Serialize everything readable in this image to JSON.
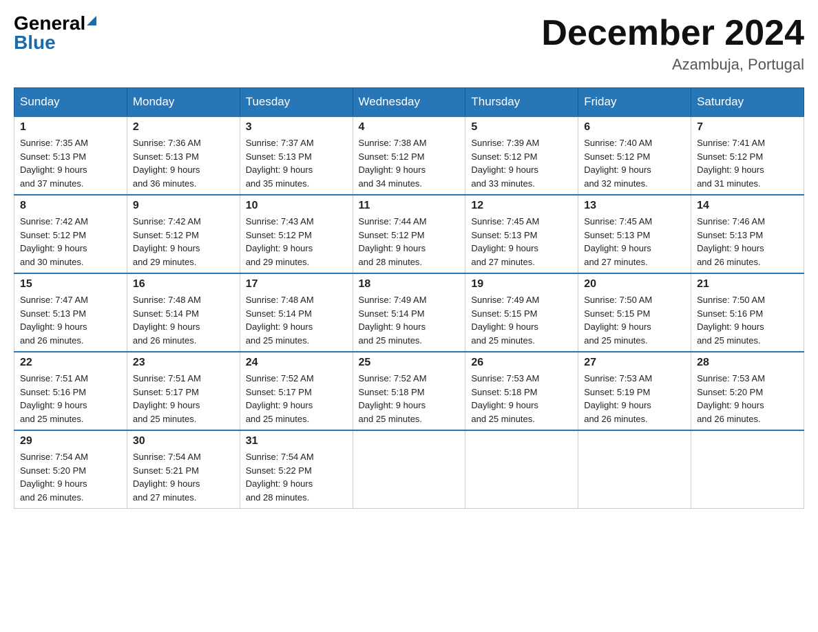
{
  "header": {
    "logo_general": "General",
    "logo_blue": "Blue",
    "month_title": "December 2024",
    "location": "Azambuja, Portugal"
  },
  "days_of_week": [
    "Sunday",
    "Monday",
    "Tuesday",
    "Wednesday",
    "Thursday",
    "Friday",
    "Saturday"
  ],
  "weeks": [
    [
      {
        "day": "1",
        "sunrise": "7:35 AM",
        "sunset": "5:13 PM",
        "daylight": "9 hours and 37 minutes."
      },
      {
        "day": "2",
        "sunrise": "7:36 AM",
        "sunset": "5:13 PM",
        "daylight": "9 hours and 36 minutes."
      },
      {
        "day": "3",
        "sunrise": "7:37 AM",
        "sunset": "5:13 PM",
        "daylight": "9 hours and 35 minutes."
      },
      {
        "day": "4",
        "sunrise": "7:38 AM",
        "sunset": "5:12 PM",
        "daylight": "9 hours and 34 minutes."
      },
      {
        "day": "5",
        "sunrise": "7:39 AM",
        "sunset": "5:12 PM",
        "daylight": "9 hours and 33 minutes."
      },
      {
        "day": "6",
        "sunrise": "7:40 AM",
        "sunset": "5:12 PM",
        "daylight": "9 hours and 32 minutes."
      },
      {
        "day": "7",
        "sunrise": "7:41 AM",
        "sunset": "5:12 PM",
        "daylight": "9 hours and 31 minutes."
      }
    ],
    [
      {
        "day": "8",
        "sunrise": "7:42 AM",
        "sunset": "5:12 PM",
        "daylight": "9 hours and 30 minutes."
      },
      {
        "day": "9",
        "sunrise": "7:42 AM",
        "sunset": "5:12 PM",
        "daylight": "9 hours and 29 minutes."
      },
      {
        "day": "10",
        "sunrise": "7:43 AM",
        "sunset": "5:12 PM",
        "daylight": "9 hours and 29 minutes."
      },
      {
        "day": "11",
        "sunrise": "7:44 AM",
        "sunset": "5:12 PM",
        "daylight": "9 hours and 28 minutes."
      },
      {
        "day": "12",
        "sunrise": "7:45 AM",
        "sunset": "5:13 PM",
        "daylight": "9 hours and 27 minutes."
      },
      {
        "day": "13",
        "sunrise": "7:45 AM",
        "sunset": "5:13 PM",
        "daylight": "9 hours and 27 minutes."
      },
      {
        "day": "14",
        "sunrise": "7:46 AM",
        "sunset": "5:13 PM",
        "daylight": "9 hours and 26 minutes."
      }
    ],
    [
      {
        "day": "15",
        "sunrise": "7:47 AM",
        "sunset": "5:13 PM",
        "daylight": "9 hours and 26 minutes."
      },
      {
        "day": "16",
        "sunrise": "7:48 AM",
        "sunset": "5:14 PM",
        "daylight": "9 hours and 26 minutes."
      },
      {
        "day": "17",
        "sunrise": "7:48 AM",
        "sunset": "5:14 PM",
        "daylight": "9 hours and 25 minutes."
      },
      {
        "day": "18",
        "sunrise": "7:49 AM",
        "sunset": "5:14 PM",
        "daylight": "9 hours and 25 minutes."
      },
      {
        "day": "19",
        "sunrise": "7:49 AM",
        "sunset": "5:15 PM",
        "daylight": "9 hours and 25 minutes."
      },
      {
        "day": "20",
        "sunrise": "7:50 AM",
        "sunset": "5:15 PM",
        "daylight": "9 hours and 25 minutes."
      },
      {
        "day": "21",
        "sunrise": "7:50 AM",
        "sunset": "5:16 PM",
        "daylight": "9 hours and 25 minutes."
      }
    ],
    [
      {
        "day": "22",
        "sunrise": "7:51 AM",
        "sunset": "5:16 PM",
        "daylight": "9 hours and 25 minutes."
      },
      {
        "day": "23",
        "sunrise": "7:51 AM",
        "sunset": "5:17 PM",
        "daylight": "9 hours and 25 minutes."
      },
      {
        "day": "24",
        "sunrise": "7:52 AM",
        "sunset": "5:17 PM",
        "daylight": "9 hours and 25 minutes."
      },
      {
        "day": "25",
        "sunrise": "7:52 AM",
        "sunset": "5:18 PM",
        "daylight": "9 hours and 25 minutes."
      },
      {
        "day": "26",
        "sunrise": "7:53 AM",
        "sunset": "5:18 PM",
        "daylight": "9 hours and 25 minutes."
      },
      {
        "day": "27",
        "sunrise": "7:53 AM",
        "sunset": "5:19 PM",
        "daylight": "9 hours and 26 minutes."
      },
      {
        "day": "28",
        "sunrise": "7:53 AM",
        "sunset": "5:20 PM",
        "daylight": "9 hours and 26 minutes."
      }
    ],
    [
      {
        "day": "29",
        "sunrise": "7:54 AM",
        "sunset": "5:20 PM",
        "daylight": "9 hours and 26 minutes."
      },
      {
        "day": "30",
        "sunrise": "7:54 AM",
        "sunset": "5:21 PM",
        "daylight": "9 hours and 27 minutes."
      },
      {
        "day": "31",
        "sunrise": "7:54 AM",
        "sunset": "5:22 PM",
        "daylight": "9 hours and 28 minutes."
      },
      null,
      null,
      null,
      null
    ]
  ],
  "labels": {
    "sunrise": "Sunrise:",
    "sunset": "Sunset:",
    "daylight": "Daylight:"
  }
}
